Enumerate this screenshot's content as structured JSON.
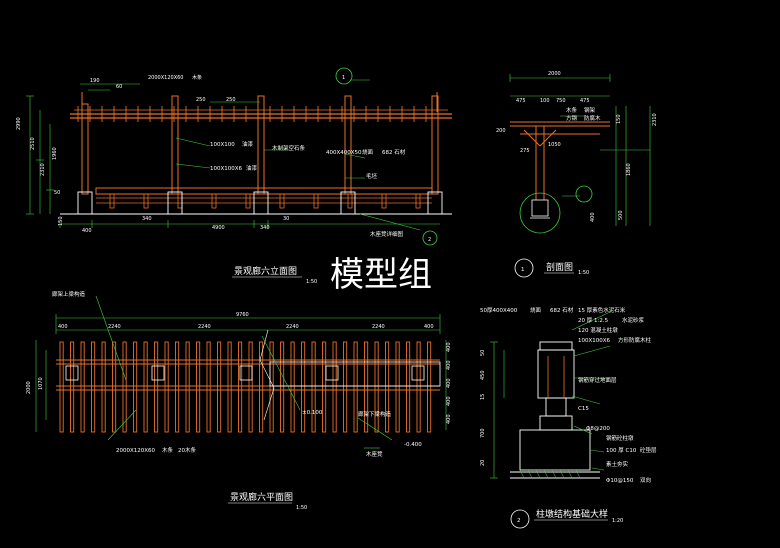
{
  "drawing": {
    "watermark": "模型组",
    "colors": {
      "background": "#000000",
      "timber": "#e8712a",
      "dimension": "#3ecf3e",
      "text": "#ffffff",
      "annotation": "#ffffff",
      "marker": "#3ecf3e"
    }
  },
  "elevation": {
    "title": "景观廊六立面图",
    "scale": "1:50",
    "dims_top": [
      "190",
      "60",
      "2000X120X60",
      "木条",
      "250",
      "250"
    ],
    "dims_left": [
      "2990",
      "2510",
      "2310",
      "1960",
      "50",
      "150"
    ],
    "dims_bottom": [
      "400",
      "340",
      "4900",
      "340",
      "30"
    ],
    "annotations": [
      "100X100",
      "油漆",
      "100X100X6",
      "油漆",
      "木制架空石条",
      "400X400X50",
      "烧面",
      "682 石材",
      "毛坯",
      "木座凳详细图"
    ],
    "detail_marker": "1",
    "detail_marker2": "2"
  },
  "section": {
    "title": "剖面图",
    "scale": "1:50",
    "marker": "1",
    "dims_top": [
      "2000",
      "475",
      "100",
      "750",
      "475"
    ],
    "dims_side": [
      "200",
      "275",
      "1050",
      "150",
      "2310",
      "1860",
      "400",
      "500"
    ],
    "labels": [
      "木条",
      "钢架",
      "方钢",
      "防腐木"
    ]
  },
  "plan": {
    "title": "景观廊六平面图",
    "scale": "1:50",
    "dims_top": [
      "9760",
      "400",
      "2240",
      "2240",
      "2240",
      "2240",
      "400"
    ],
    "dims_left": [
      "2000",
      "1070"
    ],
    "dims_right": [
      "400",
      "400",
      "400",
      "400",
      "400"
    ],
    "labels": [
      "廊架上梁构造",
      "廊架下梁构造",
      "木座凳",
      "2000X120X60",
      "木条",
      "20木条",
      "±0.100",
      "-0.400"
    ]
  },
  "foundation": {
    "title": "柱墩结构基础大样",
    "scale": "1:20",
    "marker": "2",
    "layers": [
      "50厚400X400",
      "烧面",
      "682 石材",
      "15 厚素色水泥石米",
      "20 厚 1:2.5",
      "水泥砂浆",
      "120 混凝土柱墩",
      "100X100X6",
      "方形防腐木柱"
    ],
    "labels": [
      "钢筋穿过地面层",
      "C15",
      "Φ8@200",
      "钢筋砼柱墩",
      "100 厚 C10",
      "砼垫层",
      "素土夯实",
      "Φ10@150",
      "双向"
    ],
    "dims_left": [
      "50",
      "450",
      "15",
      "700",
      "20"
    ]
  }
}
